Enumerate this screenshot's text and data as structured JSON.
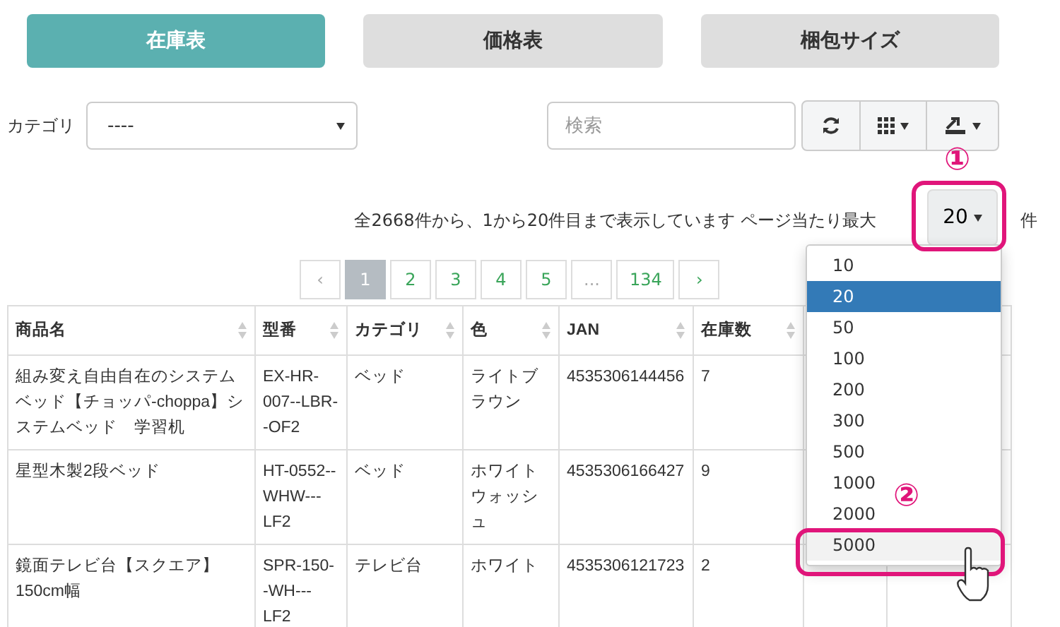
{
  "tabs": [
    {
      "label": "在庫表",
      "selected": true
    },
    {
      "label": "価格表",
      "selected": false
    },
    {
      "label": "梱包サイズ",
      "selected": false
    }
  ],
  "filter": {
    "label": "カテゴリ",
    "value": "----"
  },
  "search": {
    "placeholder": "検索"
  },
  "pagination_info": {
    "text": "全2668件から、1から20件目まで表示しています ページ当たり最大",
    "page_size": "20",
    "unit": "件"
  },
  "pages": [
    {
      "label": "‹",
      "selected": false,
      "disabled": true
    },
    {
      "label": "1",
      "selected": true,
      "disabled": false
    },
    {
      "label": "2",
      "selected": false,
      "disabled": false
    },
    {
      "label": "3",
      "selected": false,
      "disabled": false
    },
    {
      "label": "4",
      "selected": false,
      "disabled": false
    },
    {
      "label": "5",
      "selected": false,
      "disabled": false
    },
    {
      "label": "...",
      "selected": false,
      "disabled": true
    },
    {
      "label": "134",
      "selected": false,
      "disabled": false
    },
    {
      "label": "›",
      "selected": false,
      "disabled": false
    }
  ],
  "table": {
    "columns": [
      "商品名",
      "型番",
      "カテゴリ",
      "色",
      "JAN",
      "在庫数"
    ],
    "rows": [
      [
        "組み変え自由自在のシステムベッド【チョッパ-choppa】システムベッド　学習机",
        "EX-HR-007--LBR--OF2",
        "ベッド",
        "ライトブラウン",
        "4535306144456",
        "7"
      ],
      [
        "星型木製2段ベッド",
        "HT-0552--WHW---LF2",
        "ベッド",
        "ホワイトウォッシュ",
        "4535306166427",
        "9"
      ],
      [
        "鏡面テレビ台【スクエア】150cm幅",
        "SPR-150--WH---LF2",
        "テレビ台",
        "ホワイト",
        "4535306121723",
        "2"
      ]
    ]
  },
  "page_size_menu": {
    "options": [
      {
        "label": "10",
        "selected": false,
        "hovered": false
      },
      {
        "label": "20",
        "selected": true,
        "hovered": false
      },
      {
        "label": "50",
        "selected": false,
        "hovered": false
      },
      {
        "label": "100",
        "selected": false,
        "hovered": false
      },
      {
        "label": "200",
        "selected": false,
        "hovered": false
      },
      {
        "label": "300",
        "selected": false,
        "hovered": false
      },
      {
        "label": "500",
        "selected": false,
        "hovered": false
      },
      {
        "label": "1000",
        "selected": false,
        "hovered": false
      },
      {
        "label": "2000",
        "selected": false,
        "hovered": false
      },
      {
        "label": "5000",
        "selected": false,
        "hovered": true
      }
    ]
  },
  "annotations": [
    {
      "label": "①"
    },
    {
      "label": "②"
    }
  ]
}
